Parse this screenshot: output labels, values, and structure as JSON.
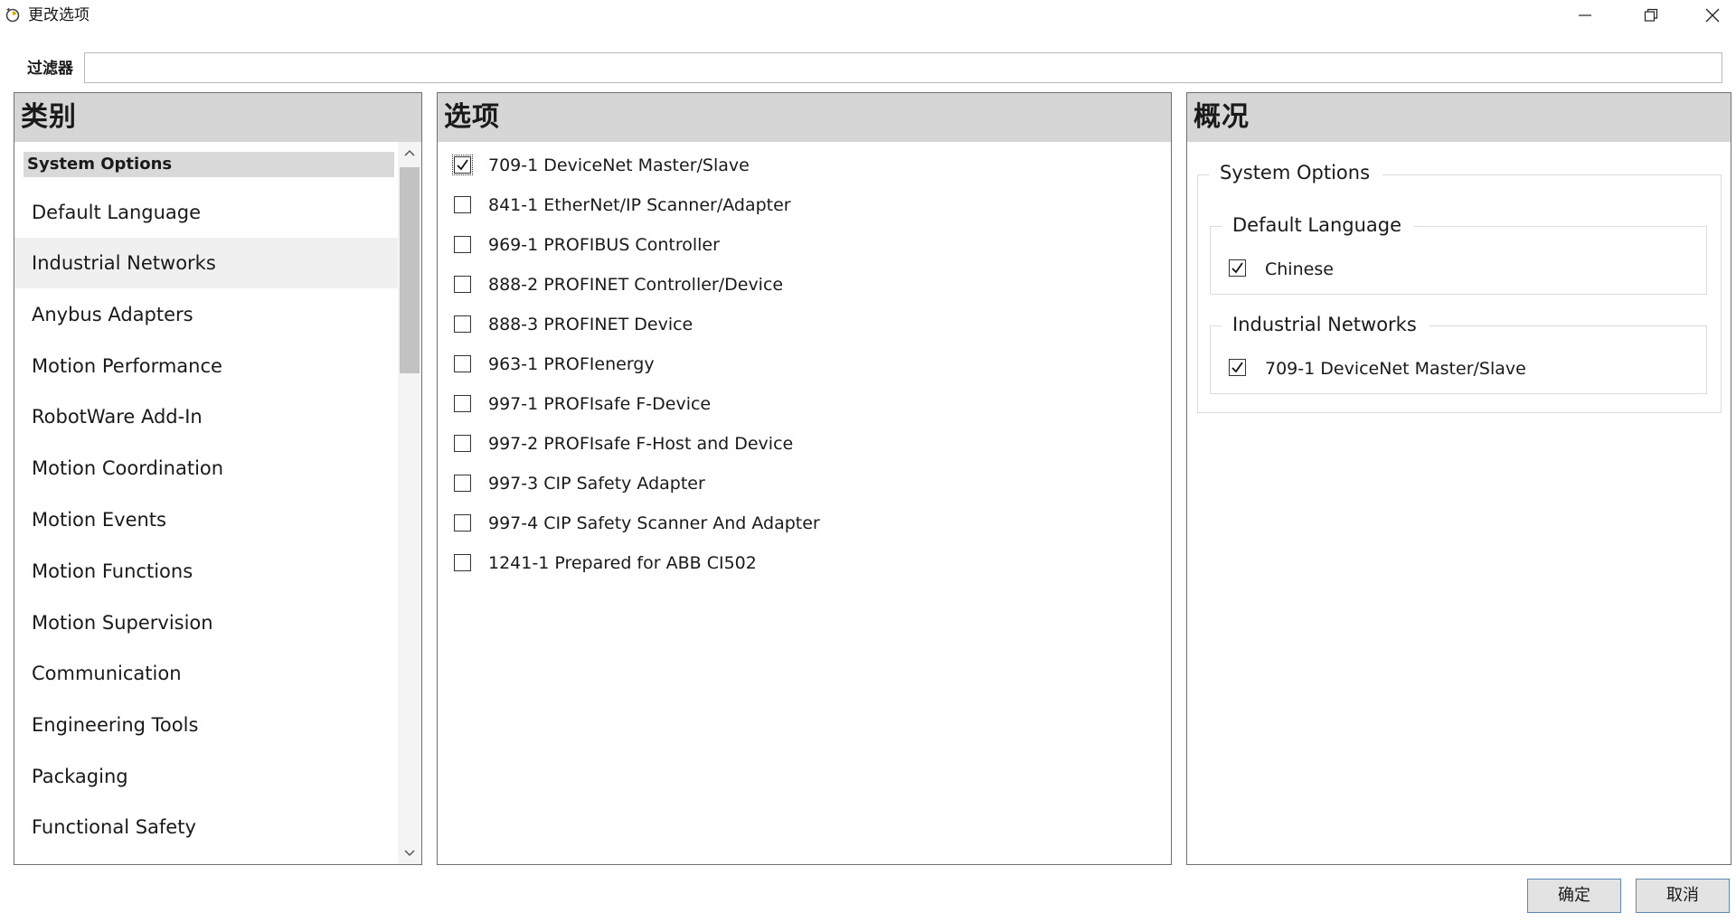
{
  "window": {
    "title": "更改选项",
    "icon": "rotate-icon"
  },
  "filter": {
    "label": "过滤器",
    "value": "",
    "placeholder": ""
  },
  "categories": {
    "header": "类别",
    "group": "System Options",
    "items": [
      {
        "label": "Default Language",
        "selected": false
      },
      {
        "label": "Industrial Networks",
        "selected": true
      },
      {
        "label": "Anybus Adapters",
        "selected": false
      },
      {
        "label": "Motion Performance",
        "selected": false
      },
      {
        "label": "RobotWare Add-In",
        "selected": false
      },
      {
        "label": "Motion Coordination",
        "selected": false
      },
      {
        "label": "Motion Events",
        "selected": false
      },
      {
        "label": "Motion Functions",
        "selected": false
      },
      {
        "label": "Motion Supervision",
        "selected": false
      },
      {
        "label": "Communication",
        "selected": false
      },
      {
        "label": "Engineering Tools",
        "selected": false
      },
      {
        "label": "Packaging",
        "selected": false
      },
      {
        "label": "Functional Safety",
        "selected": false
      }
    ]
  },
  "options": {
    "header": "选项",
    "items": [
      {
        "label": "709-1 DeviceNet Master/Slave",
        "checked": true
      },
      {
        "label": "841-1 EtherNet/IP Scanner/Adapter",
        "checked": false
      },
      {
        "label": "969-1 PROFIBUS Controller",
        "checked": false
      },
      {
        "label": "888-2 PROFINET Controller/Device",
        "checked": false
      },
      {
        "label": "888-3 PROFINET Device",
        "checked": false
      },
      {
        "label": "963-1 PROFIenergy",
        "checked": false
      },
      {
        "label": "997-1 PROFIsafe F-Device",
        "checked": false
      },
      {
        "label": "997-2 PROFIsafe F-Host and Device",
        "checked": false
      },
      {
        "label": "997-3 CIP Safety Adapter",
        "checked": false
      },
      {
        "label": "997-4 CIP Safety Scanner And Adapter",
        "checked": false
      },
      {
        "label": "1241-1 Prepared for ABB CI502",
        "checked": false
      }
    ]
  },
  "summary": {
    "header": "概况",
    "group": "System Options",
    "sections": [
      {
        "title": "Default Language",
        "items": [
          {
            "label": "Chinese",
            "checked": true
          }
        ]
      },
      {
        "title": "Industrial Networks",
        "items": [
          {
            "label": "709-1 DeviceNet Master/Slave",
            "checked": true
          }
        ]
      }
    ]
  },
  "buttons": {
    "ok": "确定",
    "cancel": "取消"
  }
}
